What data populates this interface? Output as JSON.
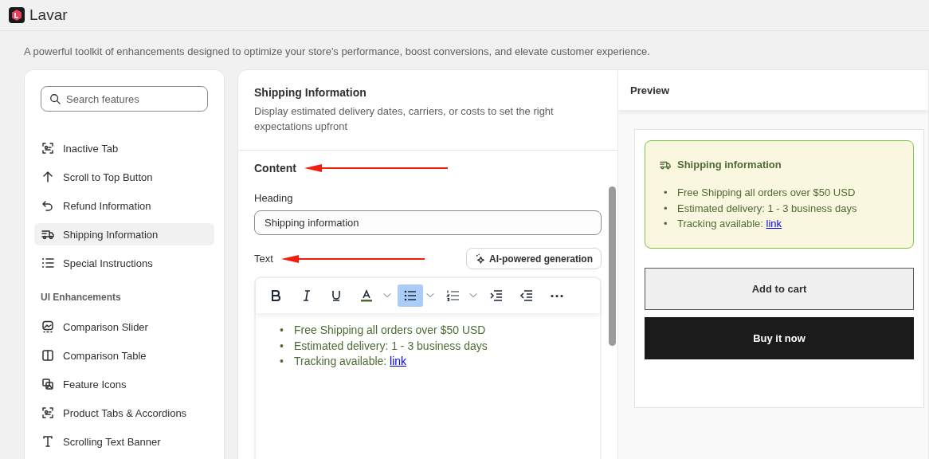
{
  "app": {
    "name": "Lavar"
  },
  "page": {
    "subtitle": "A powerful toolkit of enhancements designed to optimize your store's performance, boost conversions, and elevate customer experience."
  },
  "sidebar": {
    "search": {
      "placeholder": "Search features"
    },
    "sections": [
      {
        "items": [
          {
            "kind": "tabs",
            "label": "Inactive Tab",
            "selected": false
          },
          {
            "kind": "up",
            "label": "Scroll to Top Button",
            "selected": false
          },
          {
            "kind": "undo",
            "label": "Refund Information",
            "selected": false
          },
          {
            "kind": "truck",
            "label": "Shipping Information",
            "selected": true
          },
          {
            "kind": "list",
            "label": "Special Instructions",
            "selected": false
          }
        ]
      },
      {
        "title": "UI Enhancements",
        "items": [
          {
            "kind": "slider",
            "label": "Comparison Slider",
            "selected": false
          },
          {
            "kind": "columns",
            "label": "Comparison Table",
            "selected": false
          },
          {
            "kind": "image",
            "label": "Feature Icons",
            "selected": false
          },
          {
            "kind": "tabs",
            "label": "Product Tabs & Accordions",
            "selected": false
          },
          {
            "kind": "type",
            "label": "Scrolling Text Banner",
            "selected": false
          }
        ]
      }
    ]
  },
  "editor": {
    "title": "Shipping Information",
    "description": "Display estimated delivery dates, carriers, or costs to set the right expectations upfront",
    "section_title": "Content",
    "section_annotated": true,
    "heading_label": "Heading",
    "heading_value": "Shipping information",
    "text_label": "Text",
    "text_annotated": true,
    "ai_button": "AI-powered generation",
    "toolbar": [
      {
        "kind": "bold",
        "selected": false
      },
      {
        "kind": "italic",
        "selected": false
      },
      {
        "kind": "underline",
        "selected": false
      },
      {
        "kind": "color",
        "selected": false
      },
      {
        "kind": "caret",
        "selected": false
      },
      {
        "kind": "bullets",
        "selected": true
      },
      {
        "kind": "caret",
        "selected": false
      },
      {
        "kind": "numbers",
        "selected": false
      },
      {
        "kind": "caret",
        "selected": false
      },
      {
        "kind": "indent",
        "selected": false
      },
      {
        "kind": "outdent",
        "selected": false
      },
      {
        "kind": "more",
        "selected": false
      }
    ],
    "lines": [
      {
        "bullet": "•",
        "text": "Free Shipping all orders over $50 USD"
      },
      {
        "bullet": "•",
        "text": "Estimated delivery: 1 - 3 business days"
      },
      {
        "bullet": "•",
        "text": "Tracking available: ",
        "link": "link"
      }
    ]
  },
  "preview": {
    "title": "Preview",
    "box_heading": "Shipping information",
    "lines": [
      {
        "bullet": "•",
        "text": "Free Shipping all orders over $50 USD"
      },
      {
        "bullet": "•",
        "text": "Estimated delivery: 1 - 3 business days"
      },
      {
        "bullet": "•",
        "text": "Tracking available: ",
        "link": "link"
      }
    ],
    "buttons": [
      {
        "kind": "secondary",
        "label": "Add to cart"
      },
      {
        "kind": "primary",
        "label": "Buy it now"
      }
    ]
  }
}
